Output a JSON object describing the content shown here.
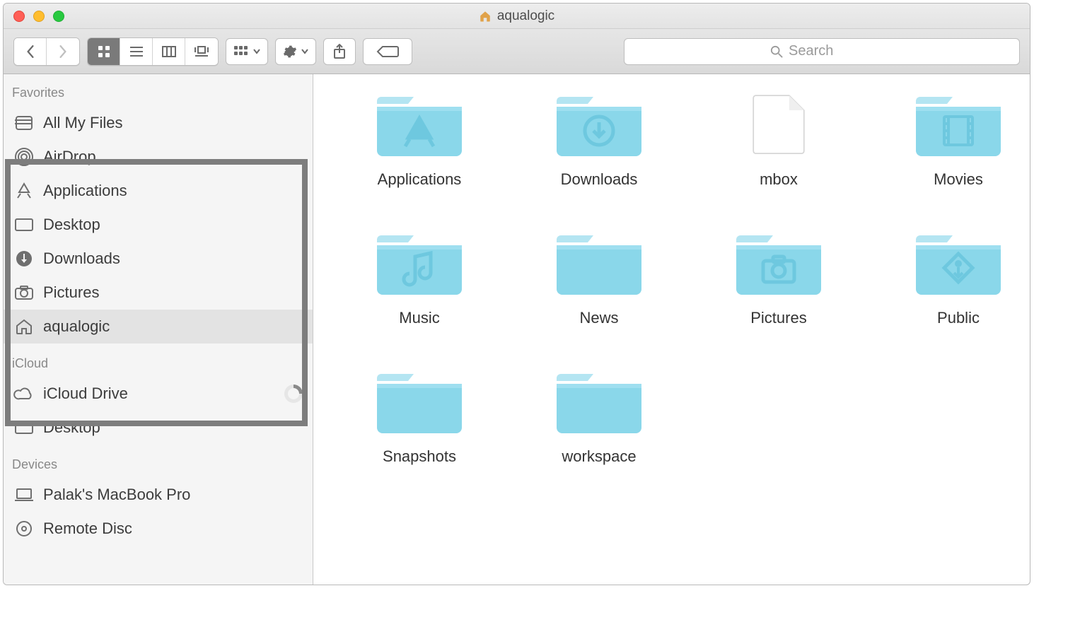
{
  "window": {
    "title": "aqualogic"
  },
  "search": {
    "placeholder": "Search"
  },
  "sidebar": {
    "sections": {
      "favorites": "Favorites",
      "icloud": "iCloud",
      "devices": "Devices"
    },
    "favorites": [
      {
        "id": "all-my-files",
        "label": "All My Files"
      },
      {
        "id": "airdrop",
        "label": "AirDrop"
      },
      {
        "id": "applications",
        "label": "Applications"
      },
      {
        "id": "desktop",
        "label": "Desktop"
      },
      {
        "id": "downloads",
        "label": "Downloads"
      },
      {
        "id": "pictures",
        "label": "Pictures"
      },
      {
        "id": "aqualogic",
        "label": "aqualogic",
        "selected": true
      }
    ],
    "icloud": [
      {
        "id": "icloud-drive",
        "label": "iCloud Drive",
        "progress": true
      },
      {
        "id": "icloud-desktop",
        "label": "Desktop"
      }
    ],
    "devices": [
      {
        "id": "macbook",
        "label": "Palak's MacBook Pro"
      },
      {
        "id": "remote",
        "label": "Remote Disc"
      }
    ]
  },
  "items": [
    {
      "id": "applications",
      "label": "Applications",
      "kind": "folder-app"
    },
    {
      "id": "downloads",
      "label": "Downloads",
      "kind": "folder-down"
    },
    {
      "id": "mbox",
      "label": "mbox",
      "kind": "file"
    },
    {
      "id": "movies",
      "label": "Movies",
      "kind": "folder-movie"
    },
    {
      "id": "music",
      "label": "Music",
      "kind": "folder-music"
    },
    {
      "id": "news",
      "label": "News",
      "kind": "folder"
    },
    {
      "id": "pictures",
      "label": "Pictures",
      "kind": "folder-camera"
    },
    {
      "id": "public",
      "label": "Public",
      "kind": "folder-public"
    },
    {
      "id": "snapshots",
      "label": "Snapshots",
      "kind": "folder"
    },
    {
      "id": "workspace",
      "label": "workspace",
      "kind": "folder"
    }
  ],
  "colors": {
    "folder": "#8ad7ea",
    "folderLight": "#b4e5f2",
    "folderGlyph": "#6ec8df"
  }
}
